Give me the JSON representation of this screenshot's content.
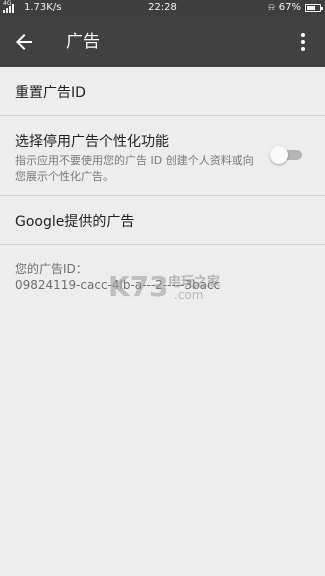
{
  "status_bar": {
    "signal_label": "4G",
    "speed": "1.73K/s",
    "time": "22:28",
    "battery": "67%",
    "battery_level": 0.67
  },
  "toolbar": {
    "title": "广告",
    "back_icon": "arrow-back-icon",
    "menu_icon": "more-vert-icon"
  },
  "settings": {
    "reset_label": "重置广告ID",
    "optout_label": "选择停用广告个性化功能",
    "optout_desc": "指示应用不要使用您的广告 ID 创建个人资料或向您展示个性化广告。",
    "optout_enabled": false,
    "google_ads_label": "Google提供的广告"
  },
  "ad_id": {
    "label": "您的广告ID：",
    "value": "09824119-cacc-4lb-a---2-----3bacc"
  },
  "watermark": {
    "logo": "K73",
    "site": "电玩之家",
    "url": ".com"
  },
  "colors": {
    "toolbar_bg": "#414141",
    "status_bg": "#3e3e3e",
    "page_bg": "#ededed"
  }
}
